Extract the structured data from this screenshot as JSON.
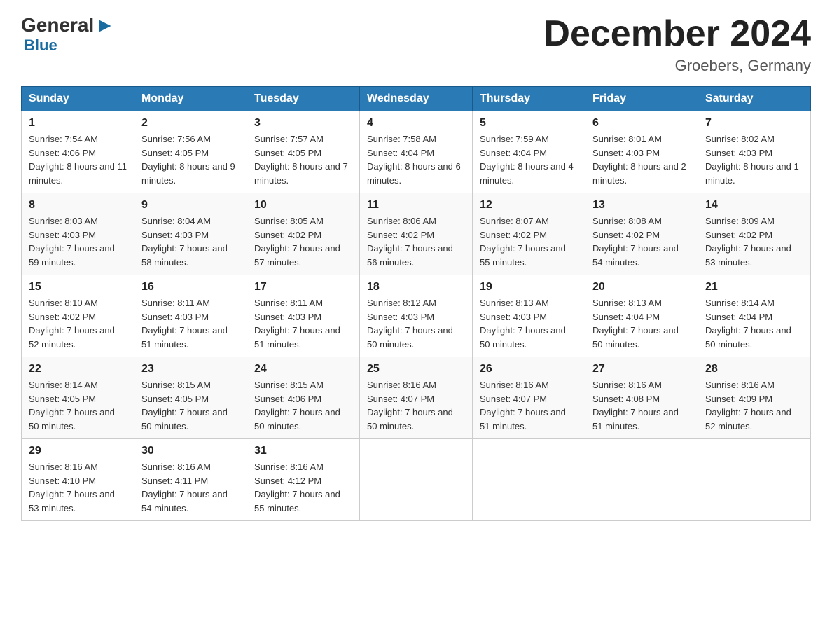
{
  "logo": {
    "general": "General",
    "arrow": "▶",
    "blue": "Blue"
  },
  "header": {
    "month": "December 2024",
    "location": "Groebers, Germany"
  },
  "days_of_week": [
    "Sunday",
    "Monday",
    "Tuesday",
    "Wednesday",
    "Thursday",
    "Friday",
    "Saturday"
  ],
  "weeks": [
    [
      {
        "day": "1",
        "sunrise": "7:54 AM",
        "sunset": "4:06 PM",
        "daylight": "8 hours and 11 minutes."
      },
      {
        "day": "2",
        "sunrise": "7:56 AM",
        "sunset": "4:05 PM",
        "daylight": "8 hours and 9 minutes."
      },
      {
        "day": "3",
        "sunrise": "7:57 AM",
        "sunset": "4:05 PM",
        "daylight": "8 hours and 7 minutes."
      },
      {
        "day": "4",
        "sunrise": "7:58 AM",
        "sunset": "4:04 PM",
        "daylight": "8 hours and 6 minutes."
      },
      {
        "day": "5",
        "sunrise": "7:59 AM",
        "sunset": "4:04 PM",
        "daylight": "8 hours and 4 minutes."
      },
      {
        "day": "6",
        "sunrise": "8:01 AM",
        "sunset": "4:03 PM",
        "daylight": "8 hours and 2 minutes."
      },
      {
        "day": "7",
        "sunrise": "8:02 AM",
        "sunset": "4:03 PM",
        "daylight": "8 hours and 1 minute."
      }
    ],
    [
      {
        "day": "8",
        "sunrise": "8:03 AM",
        "sunset": "4:03 PM",
        "daylight": "7 hours and 59 minutes."
      },
      {
        "day": "9",
        "sunrise": "8:04 AM",
        "sunset": "4:03 PM",
        "daylight": "7 hours and 58 minutes."
      },
      {
        "day": "10",
        "sunrise": "8:05 AM",
        "sunset": "4:02 PM",
        "daylight": "7 hours and 57 minutes."
      },
      {
        "day": "11",
        "sunrise": "8:06 AM",
        "sunset": "4:02 PM",
        "daylight": "7 hours and 56 minutes."
      },
      {
        "day": "12",
        "sunrise": "8:07 AM",
        "sunset": "4:02 PM",
        "daylight": "7 hours and 55 minutes."
      },
      {
        "day": "13",
        "sunrise": "8:08 AM",
        "sunset": "4:02 PM",
        "daylight": "7 hours and 54 minutes."
      },
      {
        "day": "14",
        "sunrise": "8:09 AM",
        "sunset": "4:02 PM",
        "daylight": "7 hours and 53 minutes."
      }
    ],
    [
      {
        "day": "15",
        "sunrise": "8:10 AM",
        "sunset": "4:02 PM",
        "daylight": "7 hours and 52 minutes."
      },
      {
        "day": "16",
        "sunrise": "8:11 AM",
        "sunset": "4:03 PM",
        "daylight": "7 hours and 51 minutes."
      },
      {
        "day": "17",
        "sunrise": "8:11 AM",
        "sunset": "4:03 PM",
        "daylight": "7 hours and 51 minutes."
      },
      {
        "day": "18",
        "sunrise": "8:12 AM",
        "sunset": "4:03 PM",
        "daylight": "7 hours and 50 minutes."
      },
      {
        "day": "19",
        "sunrise": "8:13 AM",
        "sunset": "4:03 PM",
        "daylight": "7 hours and 50 minutes."
      },
      {
        "day": "20",
        "sunrise": "8:13 AM",
        "sunset": "4:04 PM",
        "daylight": "7 hours and 50 minutes."
      },
      {
        "day": "21",
        "sunrise": "8:14 AM",
        "sunset": "4:04 PM",
        "daylight": "7 hours and 50 minutes."
      }
    ],
    [
      {
        "day": "22",
        "sunrise": "8:14 AM",
        "sunset": "4:05 PM",
        "daylight": "7 hours and 50 minutes."
      },
      {
        "day": "23",
        "sunrise": "8:15 AM",
        "sunset": "4:05 PM",
        "daylight": "7 hours and 50 minutes."
      },
      {
        "day": "24",
        "sunrise": "8:15 AM",
        "sunset": "4:06 PM",
        "daylight": "7 hours and 50 minutes."
      },
      {
        "day": "25",
        "sunrise": "8:16 AM",
        "sunset": "4:07 PM",
        "daylight": "7 hours and 50 minutes."
      },
      {
        "day": "26",
        "sunrise": "8:16 AM",
        "sunset": "4:07 PM",
        "daylight": "7 hours and 51 minutes."
      },
      {
        "day": "27",
        "sunrise": "8:16 AM",
        "sunset": "4:08 PM",
        "daylight": "7 hours and 51 minutes."
      },
      {
        "day": "28",
        "sunrise": "8:16 AM",
        "sunset": "4:09 PM",
        "daylight": "7 hours and 52 minutes."
      }
    ],
    [
      {
        "day": "29",
        "sunrise": "8:16 AM",
        "sunset": "4:10 PM",
        "daylight": "7 hours and 53 minutes."
      },
      {
        "day": "30",
        "sunrise": "8:16 AM",
        "sunset": "4:11 PM",
        "daylight": "7 hours and 54 minutes."
      },
      {
        "day": "31",
        "sunrise": "8:16 AM",
        "sunset": "4:12 PM",
        "daylight": "7 hours and 55 minutes."
      },
      null,
      null,
      null,
      null
    ]
  ]
}
